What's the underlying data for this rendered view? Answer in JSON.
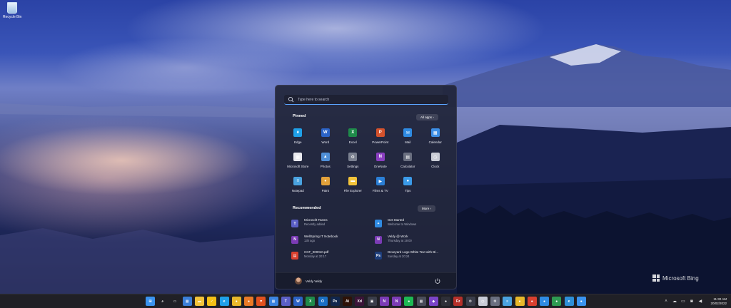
{
  "desktop": {
    "icons": [
      {
        "label": "Recycle Bin",
        "icon": "recycle-bin-icon"
      }
    ],
    "watermark": "Microsoft Bing"
  },
  "start_menu": {
    "search_placeholder": "Type here to search",
    "pinned": {
      "title": "Pinned",
      "all_apps_label": "All apps",
      "apps": [
        {
          "name": "Edge",
          "icon": "edge-icon",
          "color": "#1fa0e8",
          "glyph": "e"
        },
        {
          "name": "Word",
          "icon": "word-icon",
          "color": "#2b63c6",
          "glyph": "W"
        },
        {
          "name": "Excel",
          "icon": "excel-icon",
          "color": "#1e8a4a",
          "glyph": "X"
        },
        {
          "name": "PowerPoint",
          "icon": "powerpoint-icon",
          "color": "#d4522c",
          "glyph": "P"
        },
        {
          "name": "Mail",
          "icon": "mail-icon",
          "color": "#2f8be3",
          "glyph": "✉"
        },
        {
          "name": "Calendar",
          "icon": "calendar-icon",
          "color": "#3d8fe6",
          "glyph": "▦"
        },
        {
          "name": "Microsoft Store",
          "icon": "store-icon",
          "color": "#e9e9ef",
          "glyph": "▦"
        },
        {
          "name": "Photos",
          "icon": "photos-icon",
          "color": "#4f8fd8",
          "glyph": "▲"
        },
        {
          "name": "Settings",
          "icon": "settings-icon",
          "color": "#7a8090",
          "glyph": "⚙"
        },
        {
          "name": "OneNote",
          "icon": "onenote-icon",
          "color": "#8b3fc1",
          "glyph": "N"
        },
        {
          "name": "Calculator",
          "icon": "calculator-icon",
          "color": "#6a6f80",
          "glyph": "▤"
        },
        {
          "name": "Clock",
          "icon": "clock-icon",
          "color": "#c9ccd6",
          "glyph": "◷"
        },
        {
          "name": "Notepad",
          "icon": "notepad-icon",
          "color": "#4aa3e0",
          "glyph": "≡"
        },
        {
          "name": "Paint",
          "icon": "paint-icon",
          "color": "#e2a13a",
          "glyph": "◕"
        },
        {
          "name": "File Explorer",
          "icon": "file-explorer-icon",
          "color": "#f2c33a",
          "glyph": "▬"
        },
        {
          "name": "Films & TV",
          "icon": "films-tv-icon",
          "color": "#2b7fd6",
          "glyph": "▶"
        },
        {
          "name": "Tips",
          "icon": "tips-icon",
          "color": "#3a9ae8",
          "glyph": "●"
        }
      ]
    },
    "recommended": {
      "title": "Recommended",
      "more_label": "More",
      "items": [
        {
          "title": "Microsoft Teams",
          "subtitle": "Recently added",
          "icon": "teams-icon",
          "color": "#5b5fc7",
          "glyph": "T"
        },
        {
          "title": "Get Started",
          "subtitle": "Welcome to Windows",
          "icon": "get-started-icon",
          "color": "#2f8be3",
          "glyph": "✦"
        },
        {
          "title": "WellSpring IT Notebook",
          "subtitle": "13h ago",
          "icon": "onenote-file-icon",
          "color": "#7b3bb5",
          "glyph": "N"
        },
        {
          "title": "Veldy @ Work",
          "subtitle": "Thursday at 19:00",
          "icon": "onenote-file-icon",
          "color": "#7b3bb5",
          "glyph": "N"
        },
        {
          "title": "CCF_000010.pdf",
          "subtitle": "Monday at 20:17",
          "icon": "pdf-file-icon",
          "color": "#d9402f",
          "glyph": "▤"
        },
        {
          "title": "Deveyard Logo White Text with Bl...",
          "subtitle": "Sunday at 20:24",
          "icon": "photoshop-file-icon",
          "color": "#1d3d7a",
          "glyph": "Ps"
        }
      ]
    },
    "user": {
      "name": "Veldy Veldy"
    }
  },
  "taskbar": {
    "icons": [
      {
        "name": "start-button",
        "color": "#3a93ef",
        "glyph": "⊞"
      },
      {
        "name": "search-icon",
        "color": "transparent",
        "glyph": "⌕"
      },
      {
        "name": "task-view-icon",
        "color": "transparent",
        "glyph": "▭"
      },
      {
        "name": "widgets-icon",
        "color": "#3a7fd8",
        "glyph": "▦"
      },
      {
        "name": "file-explorer-icon",
        "color": "#f2c33a",
        "glyph": "▬"
      },
      {
        "name": "norton-icon",
        "color": "#f4c016",
        "glyph": "✓"
      },
      {
        "name": "edge-icon",
        "color": "#1fa0e8",
        "glyph": "e"
      },
      {
        "name": "chrome-icon",
        "color": "#e8b82a",
        "glyph": "●"
      },
      {
        "name": "firefox-icon",
        "color": "#ea7a26",
        "glyph": "●"
      },
      {
        "name": "brave-icon",
        "color": "#e2521f",
        "glyph": "▼"
      },
      {
        "name": "store-icon",
        "color": "#3b84e0",
        "glyph": "▦"
      },
      {
        "name": "teams-icon",
        "color": "#5b5fc7",
        "glyph": "T"
      },
      {
        "name": "word-icon",
        "color": "#2b63c6",
        "glyph": "W"
      },
      {
        "name": "excel-icon",
        "color": "#1e8a4a",
        "glyph": "X"
      },
      {
        "name": "outlook-icon",
        "color": "#1a6fc4",
        "glyph": "O"
      },
      {
        "name": "photoshop-icon",
        "color": "#10264d",
        "glyph": "Ps"
      },
      {
        "name": "illustrator-icon",
        "color": "#2e1208",
        "glyph": "Ai"
      },
      {
        "name": "xd-icon",
        "color": "#3a1438",
        "glyph": "Xd"
      },
      {
        "name": "app-icon",
        "color": "#3a3d4a",
        "glyph": "▣"
      },
      {
        "name": "onenote-icon",
        "color": "#7b3bb5",
        "glyph": "N"
      },
      {
        "name": "onenote-alt-icon",
        "color": "#7b3bb5",
        "glyph": "N"
      },
      {
        "name": "spotify-icon",
        "color": "#1db954",
        "glyph": "●"
      },
      {
        "name": "app-grid-icon",
        "color": "#4a4d5a",
        "glyph": "▦"
      },
      {
        "name": "visual-studio-icon",
        "color": "#7a44c8",
        "glyph": "◆"
      },
      {
        "name": "github-icon",
        "color": "#2e2f38",
        "glyph": "●"
      },
      {
        "name": "filezilla-icon",
        "color": "#b5302a",
        "glyph": "Fz"
      },
      {
        "name": "app-tool-icon",
        "color": "#3a3d4a",
        "glyph": "⚙"
      },
      {
        "name": "clock-icon",
        "color": "#c9ccd6",
        "glyph": "◷"
      },
      {
        "name": "settings-icon",
        "color": "#6a6f80",
        "glyph": "⚙"
      },
      {
        "name": "notepad-icon",
        "color": "#4aa3e0",
        "glyph": "≡"
      },
      {
        "name": "chrome-alt-icon",
        "color": "#e8b82a",
        "glyph": "●"
      },
      {
        "name": "app-red-icon",
        "color": "#d9402f",
        "glyph": "●"
      },
      {
        "name": "app-blue-icon",
        "color": "#2f8be3",
        "glyph": "●"
      },
      {
        "name": "app-green-icon",
        "color": "#2e9b52",
        "glyph": "●"
      },
      {
        "name": "edge-dev-icon",
        "color": "#2e8fd8",
        "glyph": "e"
      },
      {
        "name": "app-globe-icon",
        "color": "#3a93ef",
        "glyph": "●"
      }
    ],
    "clock": {
      "time": "11:30 AM",
      "date": "20/02/2022"
    }
  }
}
